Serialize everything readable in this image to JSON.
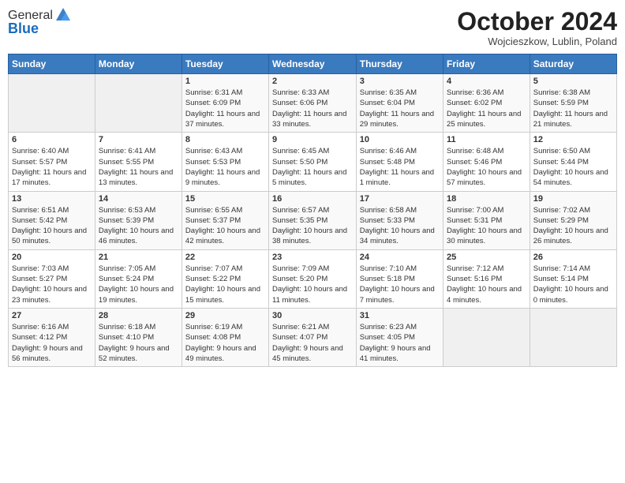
{
  "logo": {
    "general": "General",
    "blue": "Blue"
  },
  "header": {
    "month": "October 2024",
    "location": "Wojcieszkow, Lublin, Poland"
  },
  "weekdays": [
    "Sunday",
    "Monday",
    "Tuesday",
    "Wednesday",
    "Thursday",
    "Friday",
    "Saturday"
  ],
  "weeks": [
    [
      {
        "day": "",
        "content": ""
      },
      {
        "day": "",
        "content": ""
      },
      {
        "day": "1",
        "content": "Sunrise: 6:31 AM\nSunset: 6:09 PM\nDaylight: 11 hours and 37 minutes."
      },
      {
        "day": "2",
        "content": "Sunrise: 6:33 AM\nSunset: 6:06 PM\nDaylight: 11 hours and 33 minutes."
      },
      {
        "day": "3",
        "content": "Sunrise: 6:35 AM\nSunset: 6:04 PM\nDaylight: 11 hours and 29 minutes."
      },
      {
        "day": "4",
        "content": "Sunrise: 6:36 AM\nSunset: 6:02 PM\nDaylight: 11 hours and 25 minutes."
      },
      {
        "day": "5",
        "content": "Sunrise: 6:38 AM\nSunset: 5:59 PM\nDaylight: 11 hours and 21 minutes."
      }
    ],
    [
      {
        "day": "6",
        "content": "Sunrise: 6:40 AM\nSunset: 5:57 PM\nDaylight: 11 hours and 17 minutes."
      },
      {
        "day": "7",
        "content": "Sunrise: 6:41 AM\nSunset: 5:55 PM\nDaylight: 11 hours and 13 minutes."
      },
      {
        "day": "8",
        "content": "Sunrise: 6:43 AM\nSunset: 5:53 PM\nDaylight: 11 hours and 9 minutes."
      },
      {
        "day": "9",
        "content": "Sunrise: 6:45 AM\nSunset: 5:50 PM\nDaylight: 11 hours and 5 minutes."
      },
      {
        "day": "10",
        "content": "Sunrise: 6:46 AM\nSunset: 5:48 PM\nDaylight: 11 hours and 1 minute."
      },
      {
        "day": "11",
        "content": "Sunrise: 6:48 AM\nSunset: 5:46 PM\nDaylight: 10 hours and 57 minutes."
      },
      {
        "day": "12",
        "content": "Sunrise: 6:50 AM\nSunset: 5:44 PM\nDaylight: 10 hours and 54 minutes."
      }
    ],
    [
      {
        "day": "13",
        "content": "Sunrise: 6:51 AM\nSunset: 5:42 PM\nDaylight: 10 hours and 50 minutes."
      },
      {
        "day": "14",
        "content": "Sunrise: 6:53 AM\nSunset: 5:39 PM\nDaylight: 10 hours and 46 minutes."
      },
      {
        "day": "15",
        "content": "Sunrise: 6:55 AM\nSunset: 5:37 PM\nDaylight: 10 hours and 42 minutes."
      },
      {
        "day": "16",
        "content": "Sunrise: 6:57 AM\nSunset: 5:35 PM\nDaylight: 10 hours and 38 minutes."
      },
      {
        "day": "17",
        "content": "Sunrise: 6:58 AM\nSunset: 5:33 PM\nDaylight: 10 hours and 34 minutes."
      },
      {
        "day": "18",
        "content": "Sunrise: 7:00 AM\nSunset: 5:31 PM\nDaylight: 10 hours and 30 minutes."
      },
      {
        "day": "19",
        "content": "Sunrise: 7:02 AM\nSunset: 5:29 PM\nDaylight: 10 hours and 26 minutes."
      }
    ],
    [
      {
        "day": "20",
        "content": "Sunrise: 7:03 AM\nSunset: 5:27 PM\nDaylight: 10 hours and 23 minutes."
      },
      {
        "day": "21",
        "content": "Sunrise: 7:05 AM\nSunset: 5:24 PM\nDaylight: 10 hours and 19 minutes."
      },
      {
        "day": "22",
        "content": "Sunrise: 7:07 AM\nSunset: 5:22 PM\nDaylight: 10 hours and 15 minutes."
      },
      {
        "day": "23",
        "content": "Sunrise: 7:09 AM\nSunset: 5:20 PM\nDaylight: 10 hours and 11 minutes."
      },
      {
        "day": "24",
        "content": "Sunrise: 7:10 AM\nSunset: 5:18 PM\nDaylight: 10 hours and 7 minutes."
      },
      {
        "day": "25",
        "content": "Sunrise: 7:12 AM\nSunset: 5:16 PM\nDaylight: 10 hours and 4 minutes."
      },
      {
        "day": "26",
        "content": "Sunrise: 7:14 AM\nSunset: 5:14 PM\nDaylight: 10 hours and 0 minutes."
      }
    ],
    [
      {
        "day": "27",
        "content": "Sunrise: 6:16 AM\nSunset: 4:12 PM\nDaylight: 9 hours and 56 minutes."
      },
      {
        "day": "28",
        "content": "Sunrise: 6:18 AM\nSunset: 4:10 PM\nDaylight: 9 hours and 52 minutes."
      },
      {
        "day": "29",
        "content": "Sunrise: 6:19 AM\nSunset: 4:08 PM\nDaylight: 9 hours and 49 minutes."
      },
      {
        "day": "30",
        "content": "Sunrise: 6:21 AM\nSunset: 4:07 PM\nDaylight: 9 hours and 45 minutes."
      },
      {
        "day": "31",
        "content": "Sunrise: 6:23 AM\nSunset: 4:05 PM\nDaylight: 9 hours and 41 minutes."
      },
      {
        "day": "",
        "content": ""
      },
      {
        "day": "",
        "content": ""
      }
    ]
  ]
}
